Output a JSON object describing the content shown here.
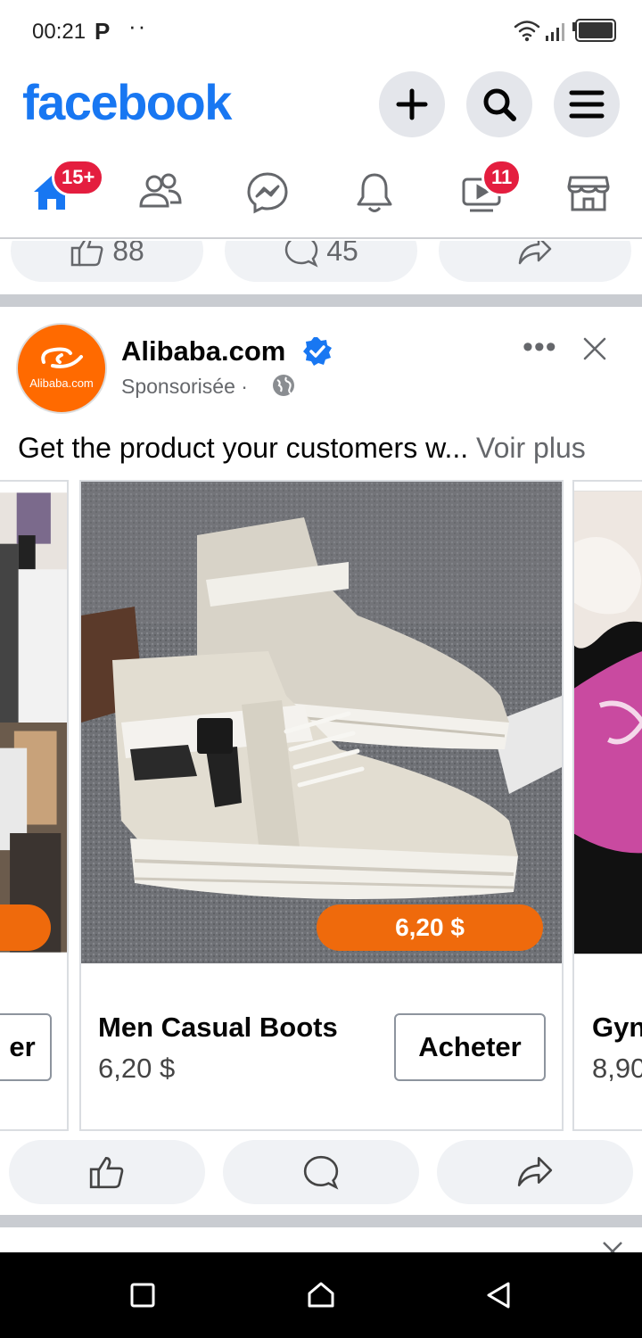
{
  "status_bar": {
    "time": "00:21",
    "notif_letter": "P",
    "dots": "··"
  },
  "header": {
    "logo": "facebook",
    "buttons": [
      "create-icon",
      "search-icon",
      "menu-icon"
    ]
  },
  "nav": {
    "home_badge": "15+",
    "watch_badge": "11",
    "items": [
      "home-icon",
      "friends-icon",
      "messenger-icon",
      "notifications-icon",
      "watch-icon",
      "marketplace-icon"
    ],
    "accent": "#1877f2"
  },
  "prev_post": {
    "likes": "88",
    "comments": "45"
  },
  "post": {
    "author": "Alibaba.com",
    "avatar_text": "Alibaba.com",
    "subtitle": "Sponsorisée ·",
    "text": "Get the product your customers w...",
    "see_more": "Voir plus",
    "carousel": [
      {
        "title": "",
        "price": "",
        "button": "er"
      },
      {
        "title": "Men Casual Boots",
        "price": "6,20 $",
        "price_tag": "6,20 $",
        "button": "Acheter"
      },
      {
        "title": "Gyn",
        "price": "8,90",
        "button": ""
      }
    ]
  },
  "colors": {
    "brand": "#1877f2",
    "badge": "#e41e3f",
    "price_tag": "#ef6a0c"
  }
}
